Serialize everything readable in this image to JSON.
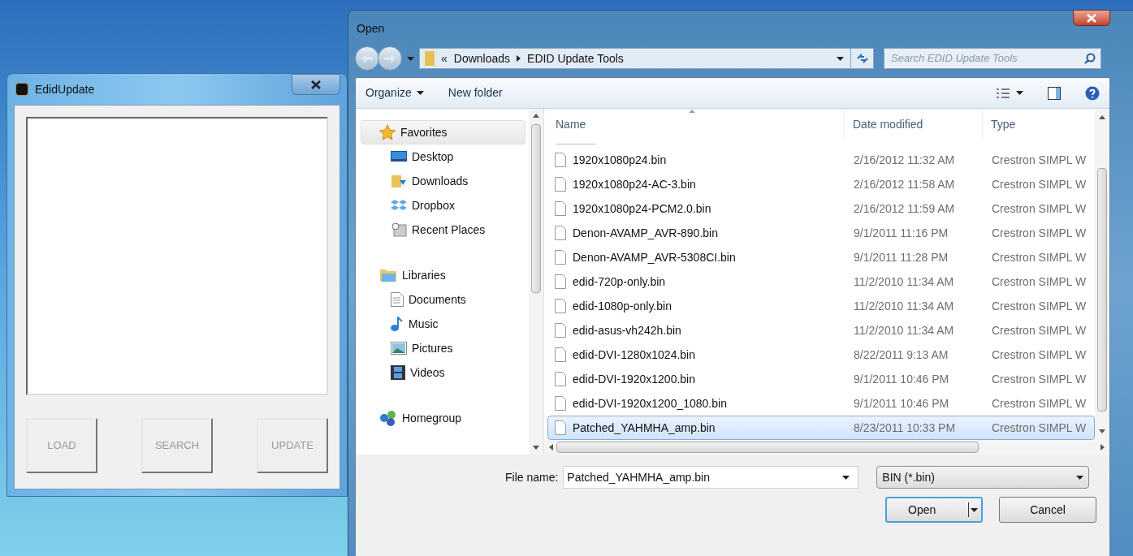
{
  "edid_window": {
    "title": "EdidUpdate",
    "buttons": [
      {
        "label": "LOAD",
        "disabled": true
      },
      {
        "label": "SEARCH",
        "disabled": true
      },
      {
        "label": "UPDATE",
        "disabled": true
      }
    ]
  },
  "open_dialog": {
    "title": "Open",
    "breadcrumb_overflow": "«",
    "breadcrumb": [
      "Downloads",
      "EDID Update Tools"
    ],
    "search": {
      "placeholder": "Search EDID Update Tools"
    },
    "toolbar": [
      {
        "label": "Organize",
        "dropdown": true
      },
      {
        "label": "New folder",
        "dropdown": false
      }
    ],
    "sidebar": [
      {
        "label": "Favorites",
        "selected": true,
        "children": [
          {
            "label": "Desktop",
            "selected": false
          },
          {
            "label": "Downloads",
            "selected": false
          },
          {
            "label": "Dropbox",
            "selected": false
          },
          {
            "label": "Recent Places",
            "selected": false
          }
        ]
      },
      {
        "label": "Libraries",
        "selected": false,
        "children": [
          {
            "label": "Documents",
            "selected": false
          },
          {
            "label": "Music",
            "selected": false
          },
          {
            "label": "Pictures",
            "selected": false
          },
          {
            "label": "Videos",
            "selected": false
          }
        ]
      },
      {
        "label": "Homegroup",
        "selected": false
      }
    ],
    "columns": [
      "Name",
      "Date modified",
      "Type"
    ],
    "rows": [
      {
        "name": "1920x1080p24.bin",
        "date": "2/16/2012 11:32 AM",
        "type": "Crestron SIMPL W",
        "selected": false
      },
      {
        "name": "1920x1080p24-AC-3.bin",
        "date": "2/16/2012 11:58 AM",
        "type": "Crestron SIMPL W",
        "selected": false
      },
      {
        "name": "1920x1080p24-PCM2.0.bin",
        "date": "2/16/2012 11:59 AM",
        "type": "Crestron SIMPL W",
        "selected": false
      },
      {
        "name": "Denon-AVAMP_AVR-890.bin",
        "date": "9/1/2011 11:16 PM",
        "type": "Crestron SIMPL W",
        "selected": false
      },
      {
        "name": "Denon-AVAMP_AVR-5308CI.bin",
        "date": "9/1/2011 11:28 PM",
        "type": "Crestron SIMPL W",
        "selected": false
      },
      {
        "name": "edid-720p-only.bin",
        "date": "11/2/2010 11:34 AM",
        "type": "Crestron SIMPL W",
        "selected": false
      },
      {
        "name": "edid-1080p-only.bin",
        "date": "11/2/2010 11:34 AM",
        "type": "Crestron SIMPL W",
        "selected": false
      },
      {
        "name": "edid-asus-vh242h.bin",
        "date": "11/2/2010 11:34 AM",
        "type": "Crestron SIMPL W",
        "selected": false
      },
      {
        "name": "edid-DVI-1280x1024.bin",
        "date": "8/22/2011 9:13 AM",
        "type": "Crestron SIMPL W",
        "selected": false
      },
      {
        "name": "edid-DVI-1920x1200.bin",
        "date": "9/1/2011 10:46 PM",
        "type": "Crestron SIMPL W",
        "selected": false
      },
      {
        "name": "edid-DVI-1920x1200_1080.bin",
        "date": "9/1/2011 10:46 PM",
        "type": "Crestron SIMPL W",
        "selected": false
      },
      {
        "name": "Patched_YAHMHA_amp.bin",
        "date": "8/23/2011 10:33 PM",
        "type": "Crestron SIMPL W",
        "selected": true
      }
    ],
    "file_name_label": "File name:",
    "file_name": "Patched_YAHMHA_amp.bin",
    "file_type": "BIN (*.bin)",
    "buttons": [
      {
        "label": "Open",
        "split": true,
        "default": true
      },
      {
        "label": "Cancel",
        "split": false,
        "default": false
      }
    ]
  }
}
